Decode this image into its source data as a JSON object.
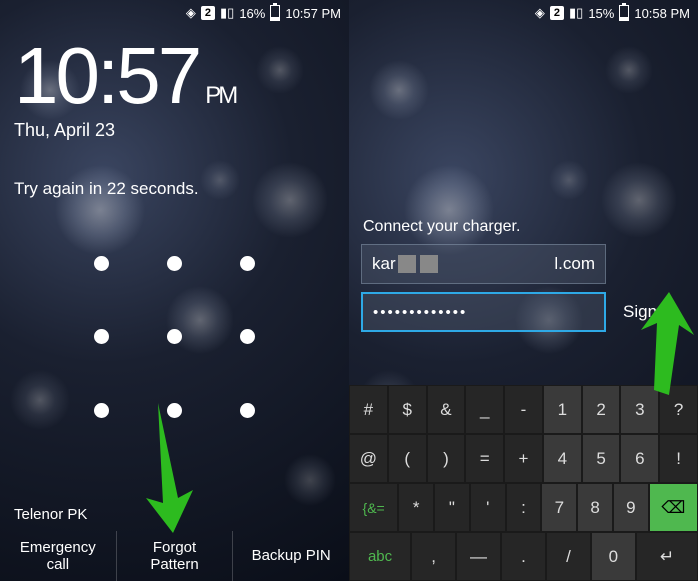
{
  "left": {
    "status": {
      "sim": "2",
      "battery": "16%",
      "time": "10:57 PM"
    },
    "clock": {
      "time": "10:57",
      "suffix": "PM",
      "date": "Thu, April 23"
    },
    "tryAgain": "Try again in 22 seconds.",
    "carrier": "Telenor PK",
    "buttons": {
      "emergency": "Emergency\ncall",
      "forgot": "Forgot\nPattern",
      "backup": "Backup PIN"
    }
  },
  "right": {
    "status": {
      "sim": "2",
      "battery": "15%",
      "time": "10:58 PM"
    },
    "chargerMsg": "Connect your charger.",
    "emailPrefix": "kar",
    "emailSuffix": "l.com",
    "password": "•••••••••••••",
    "signIn": "Sign in",
    "keyboard": {
      "row1": [
        "#",
        "$",
        "&",
        "_",
        "-",
        "1",
        "2",
        "3",
        "?"
      ],
      "row2": [
        "@",
        "(",
        ")",
        "=",
        "+",
        "4",
        "5",
        "6",
        "!"
      ],
      "row3Sym": "{&=",
      "row3": [
        "*",
        "\"",
        "'",
        ":",
        "7",
        "8",
        "9"
      ],
      "row3Back": "⌫",
      "row4Abc": "abc",
      "row4": [
        ",",
        "—",
        ".",
        "/",
        "0"
      ],
      "row4Enter": "↵"
    }
  }
}
